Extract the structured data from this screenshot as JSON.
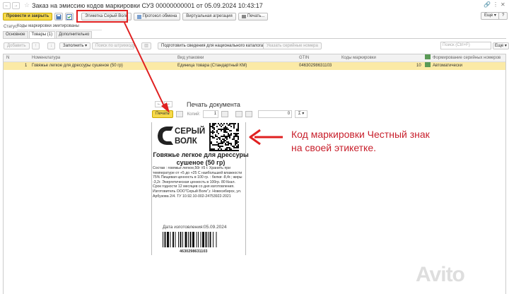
{
  "window": {
    "title": "Заказ на эмиссию кодов маркировки СУЗ 00000000001 от 05.09.2024 10:43:17",
    "nav_back": "←",
    "nav_forward": "→",
    "favorite_icon": "star-icon",
    "ctrl_link": "🔗",
    "ctrl_more": "⋮",
    "ctrl_close": "✕"
  },
  "toolbar": {
    "post_close": "Провести и закрыть",
    "label_grey_wolf": "Этикетка Серый Волк",
    "exchange_protocol": "Протокол обмена",
    "virtual_aggregation": "Виртуальная агрегация",
    "print": "Печать...",
    "more": "Еще ▾",
    "help": "?"
  },
  "status": {
    "label": "Статус:",
    "value": "Коды маркировки эмитированы"
  },
  "tabs": [
    "Основное",
    "Товары (1)",
    "Дополнительно"
  ],
  "table_toolbar": {
    "add": "Добавить",
    "fill": "Заполнить ▾",
    "search_barcode": "Поиск по штрихкоду",
    "prepare_catalog": "Подготовить сведения для национального каталога",
    "specify_serial": "Указать серийные номера",
    "search_placeholder": "Поиск (Ctrl+F)",
    "more": "Еще ▾"
  },
  "table": {
    "headers": {
      "n": "N",
      "nomenclature": "Номенклатура",
      "pack": "Вид упаковки",
      "gtin": "GTIN",
      "codes": "Коды маркировки",
      "serial": "Формирование серийных номеров"
    },
    "rows": [
      {
        "n": "1",
        "nomenclature": "Говяжье легкое для дрессуры сушеное (50 гр)",
        "pack": "Единица товара (Стандартный КМ)",
        "gtin": "04630298631103",
        "codes": "10",
        "serial": "Автоматически"
      }
    ]
  },
  "print_doc": {
    "title": "Печать документа",
    "print_btn": "Печать",
    "copies_label": "Копий:",
    "copies_value": "1",
    "total_value": "0",
    "sum_symbol": "Σ ▾"
  },
  "label": {
    "brand_line1": "СЕРЫЙ",
    "brand_line2": "ВОЛК",
    "product_name": "Говяжье легкое для дрессуры сушеное (50 гр)",
    "composition": "Состав : говяжье легкое,50г ±5 г. Хранить при температуре от +5 до +25 С наибольшей влажности 75% Пищевая ценность в 100 гр. : белки -8,4г.; жиры -3,2г. Энергетическая ценность в 100гр. 80 Ккал. Срок годности 12 месяцев со дня изготовления. Изготовитель ООО\"Серый Волк\",г. Новосибирск, ул. Арбузова 2/4. ТУ 10.92.10-002-24753922-2021",
    "date_label": "Дата изготовления:",
    "date_value": "05.09.2024",
    "ean": "4630298631103"
  },
  "annotation": "Код маркировки Честный знак на своей этикетке.",
  "watermark": "Avito",
  "colors": {
    "accent_yellow": "#f6d94a",
    "highlight_row": "#fbeaa6",
    "annotation_red": "#c8202c",
    "frame_red": "#e02020"
  }
}
